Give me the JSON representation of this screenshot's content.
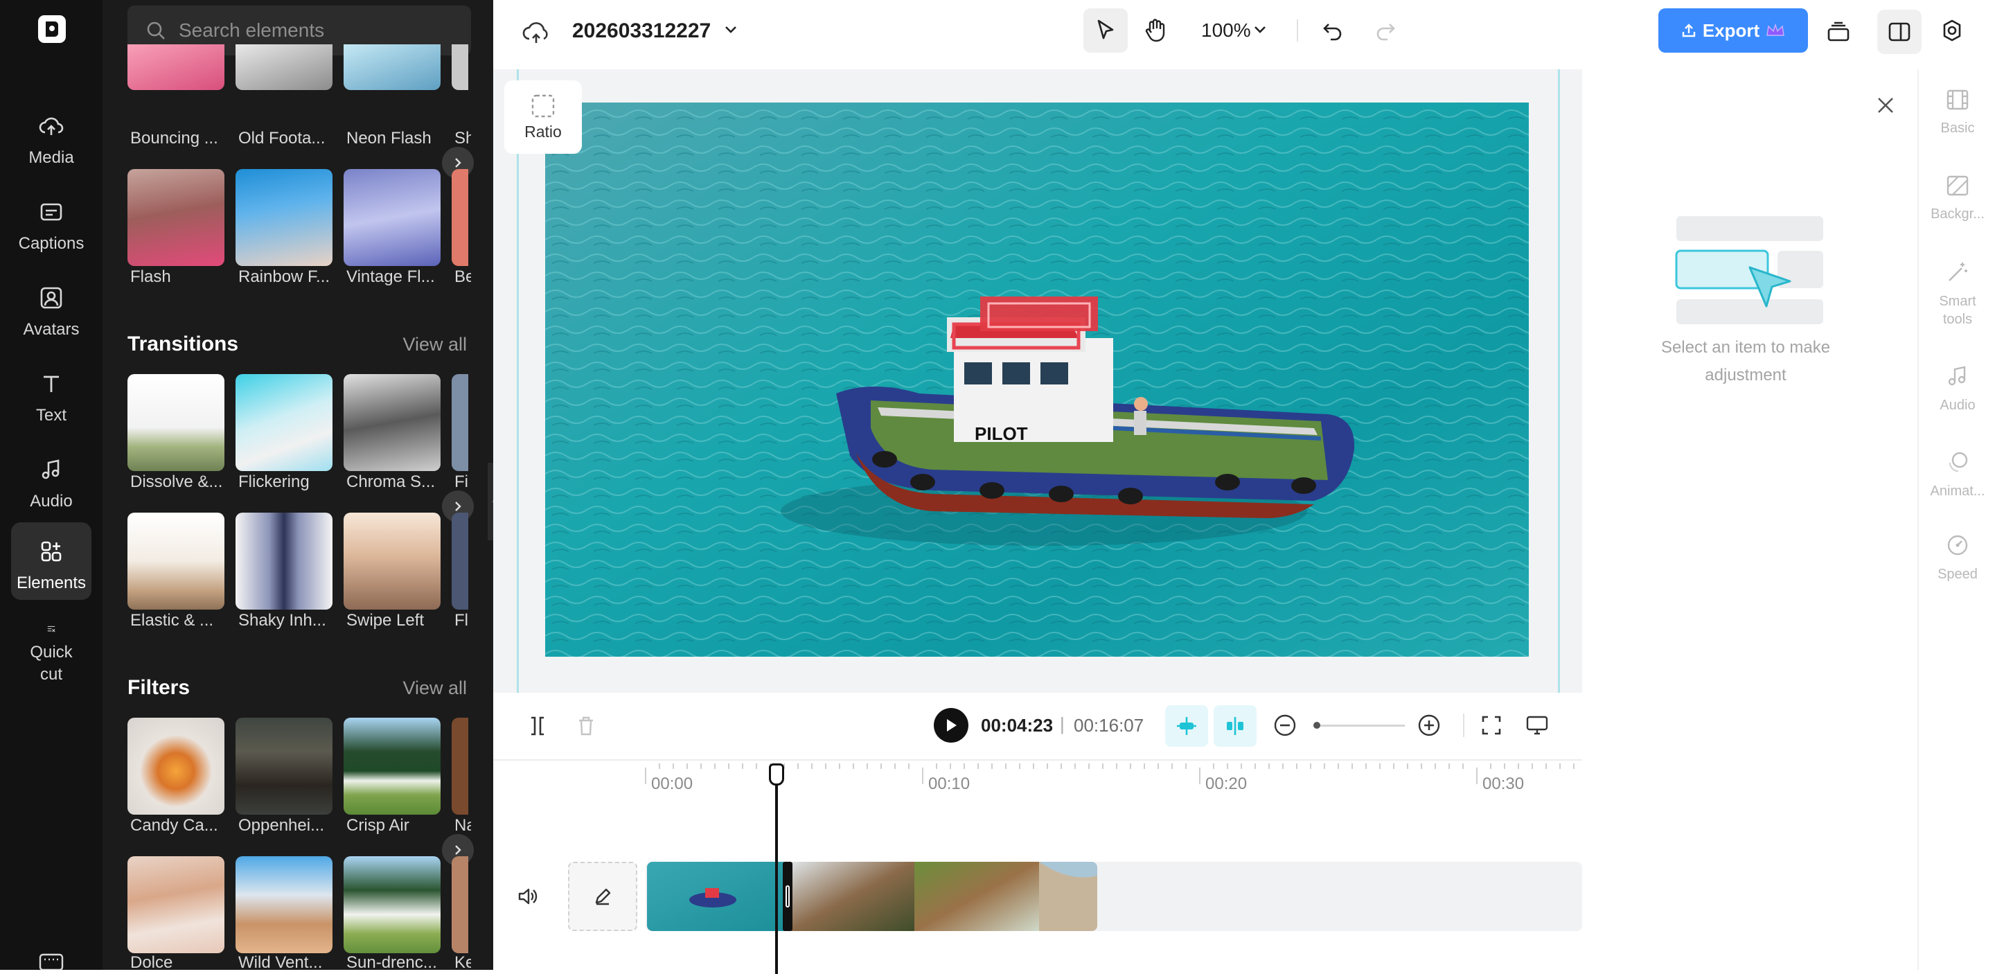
{
  "left_nav": {
    "items": [
      {
        "label": "Media",
        "icon": "cloud-upload-icon"
      },
      {
        "label": "Captions",
        "icon": "captions-icon"
      },
      {
        "label": "Avatars",
        "icon": "avatar-icon"
      },
      {
        "label": "Text",
        "icon": "text-icon"
      },
      {
        "label": "Audio",
        "icon": "music-note-icon"
      },
      {
        "label": "Elements",
        "icon": "elements-icon",
        "active": true
      },
      {
        "label": "Quick\ncut",
        "icon": "quick-cut-icon"
      }
    ]
  },
  "panel": {
    "search_placeholder": "Search elements",
    "effects_row1": [
      "Bouncing ...",
      "Old Foota...",
      "Neon Flash",
      "Sh"
    ],
    "effects_row2": [
      "Flash",
      "Rainbow F...",
      "Vintage Fl...",
      "Be"
    ],
    "transitions": {
      "title": "Transitions",
      "view_all": "View all",
      "row1": [
        "Dissolve &...",
        "Flickering",
        "Chroma S...",
        "Fi"
      ],
      "row2": [
        "Elastic & ...",
        "Shaky Inh...",
        "Swipe Left",
        "Fl"
      ]
    },
    "filters": {
      "title": "Filters",
      "view_all": "View all",
      "row1": [
        "Candy Ca...",
        "Oppenhei...",
        "Crisp Air",
        "Na"
      ],
      "row2": [
        "Dolce",
        "Wild Vent...",
        "Sun-drenc...",
        "Ke"
      ]
    }
  },
  "topbar": {
    "project_name": "202603312227",
    "zoom": "100%",
    "export_label": "Export"
  },
  "canvas": {
    "ratio_label": "Ratio",
    "boat_text": "PILOT"
  },
  "right_panel": {
    "hint": "Select an item to make adjustment",
    "tabs": [
      {
        "label": "Basic",
        "icon": "film-icon"
      },
      {
        "label": "Backgr...",
        "icon": "background-icon"
      },
      {
        "label": "Smart\ntools",
        "icon": "magic-wand-icon"
      },
      {
        "label": "Audio",
        "icon": "music-note-icon"
      },
      {
        "label": "Animat...",
        "icon": "animation-icon"
      },
      {
        "label": "Speed",
        "icon": "speed-icon"
      }
    ]
  },
  "playback": {
    "current_time": "00:04:23",
    "separator": "|",
    "total_time": "00:16:07"
  },
  "timeline": {
    "ticks": [
      "00:00",
      "00:10",
      "00:20",
      "00:30"
    ]
  },
  "colors": {
    "accent": "#3b8bff",
    "nav_bg": "#121212",
    "panel_bg": "#1b1b1b",
    "teal": "#1fc3d6"
  }
}
